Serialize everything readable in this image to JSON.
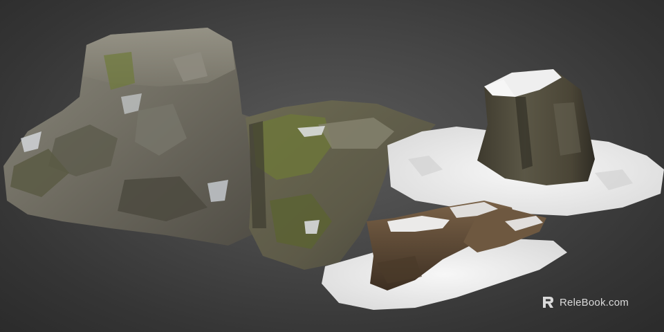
{
  "watermark": {
    "brand": "ReleBook.com",
    "icon": "relebook-logo-icon"
  },
  "scene": {
    "objects": [
      "large-mossy-rock",
      "mossy-rock-slab",
      "snowy-tree-stump",
      "snowy-broken-log"
    ],
    "colors": {
      "background_center": "#5a5a5a",
      "background_edge": "#2b2b2b",
      "rock_gray": "#7d7b70",
      "moss_green": "#6f7a3a",
      "snow_white": "#f2f2f2",
      "bark_brown": "#5a4630"
    }
  }
}
